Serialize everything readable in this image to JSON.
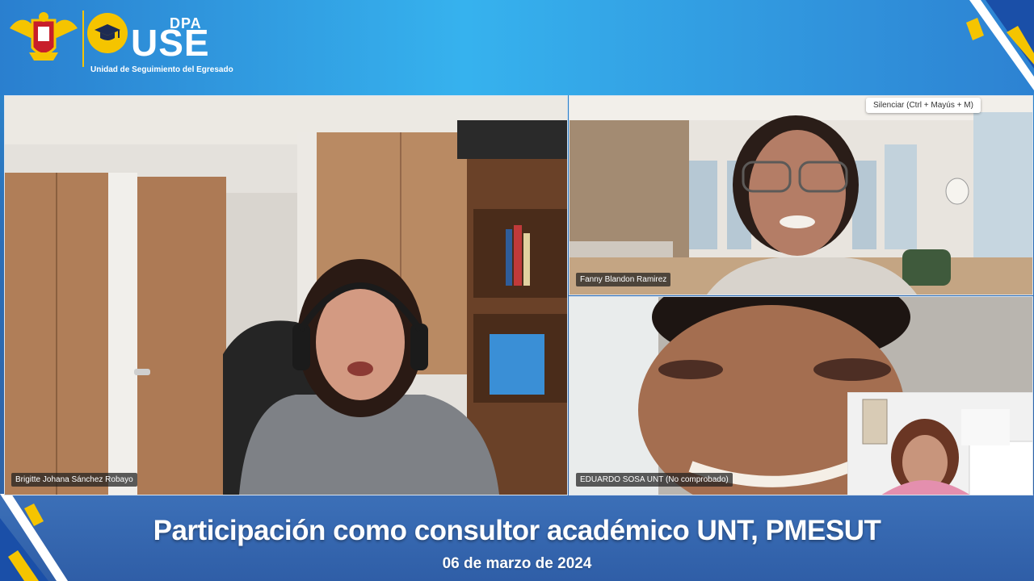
{
  "brand": {
    "top_text": "DPA",
    "name": "USE",
    "subtitle": "Unidad de Seguimiento del Egresado",
    "crest_icon": "university-crest-icon",
    "cap_icon": "graduation-cap-icon"
  },
  "participants": [
    {
      "name": "Brigitte Johana Sánchez Robayo"
    },
    {
      "name": "Fanny Blandon Ramirez"
    },
    {
      "name": "EDUARDO SOSA UNT (No comprobado)"
    }
  ],
  "tooltip": "Silenciar (Ctrl + Mayús + M)",
  "footer": {
    "title": "Participación como consultor académico UNT, PMESUT",
    "date": "06 de marzo de 2024"
  },
  "colors": {
    "accent_yellow": "#f5c400",
    "banner_blue": "#36b2ee",
    "footer_blue": "#2f5ea7"
  }
}
